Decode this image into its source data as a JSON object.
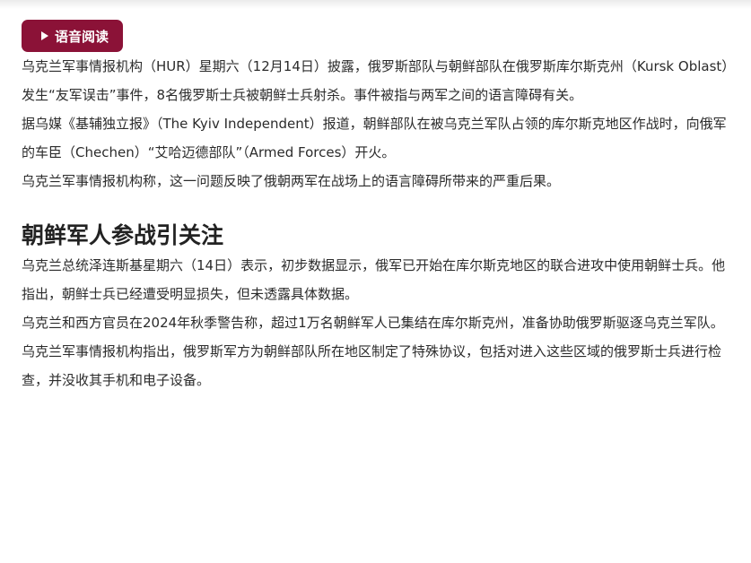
{
  "audio_button": {
    "label": "语音阅读",
    "icon": "play-icon"
  },
  "article": {
    "paragraphs_intro": [
      "乌克兰军事情报机构（HUR）星期六（12月14日）披露，俄罗斯部队与朝鲜部队在俄罗斯库尔斯克州（Kursk Oblast）发生“友军误击”事件，8名俄罗斯士兵被朝鲜士兵射杀。事件被指与两军之间的语言障碍有关。",
      "据乌媒《基辅独立报》（The Kyiv Independent）报道，朝鲜部队在被乌克兰军队占领的库尔斯克地区作战时，向俄军的车臣（Chechen）“艾哈迈德部队”（Armed Forces）开火。",
      "乌克兰军事情报机构称，这一问题反映了俄朝两军在战场上的语言障碍所带来的严重后果。"
    ],
    "section_heading": "朝鲜军人参战引关注",
    "paragraphs_section": [
      "乌克兰总统泽连斯基星期六（14日）表示，初步数据显示，俄军已开始在库尔斯克地区的联合进攻中使用朝鲜士兵。他指出，朝鲜士兵已经遭受明显损失，但未透露具体数据。",
      "乌克兰和西方官员在2024年秋季警告称，超过1万名朝鲜军人已集结在库尔斯克州，准备协助俄罗斯驱逐乌克兰军队。",
      "乌克兰军事情报机构指出，俄罗斯军方为朝鲜部队所在地区制定了特殊协议，包括对进入这些区域的俄罗斯士兵进行检查，并没收其手机和电子设备。"
    ]
  },
  "colors": {
    "accent": "#8b1237",
    "text": "#2b2b2b"
  }
}
